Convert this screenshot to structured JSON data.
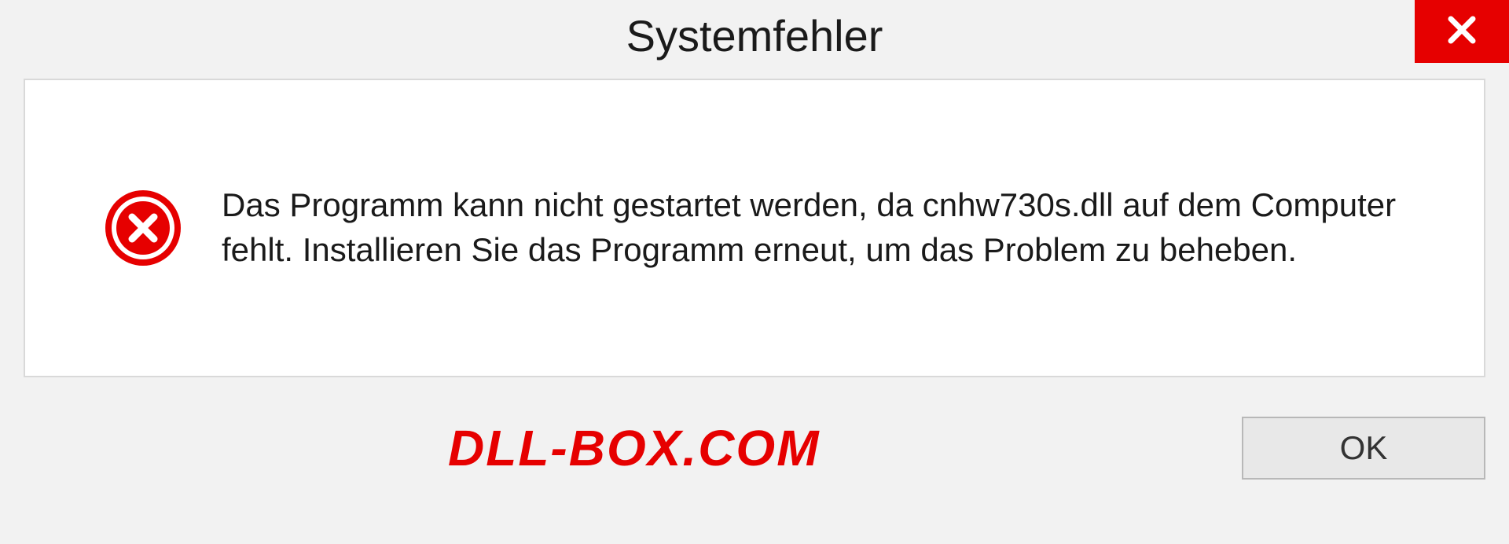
{
  "dialog": {
    "title": "Systemfehler",
    "message": "Das Programm kann nicht gestartet werden, da cnhw730s.dll auf dem Computer fehlt. Installieren Sie das Programm erneut, um das Problem zu beheben.",
    "ok_label": "OK"
  },
  "watermark": "DLL-BOX.COM"
}
